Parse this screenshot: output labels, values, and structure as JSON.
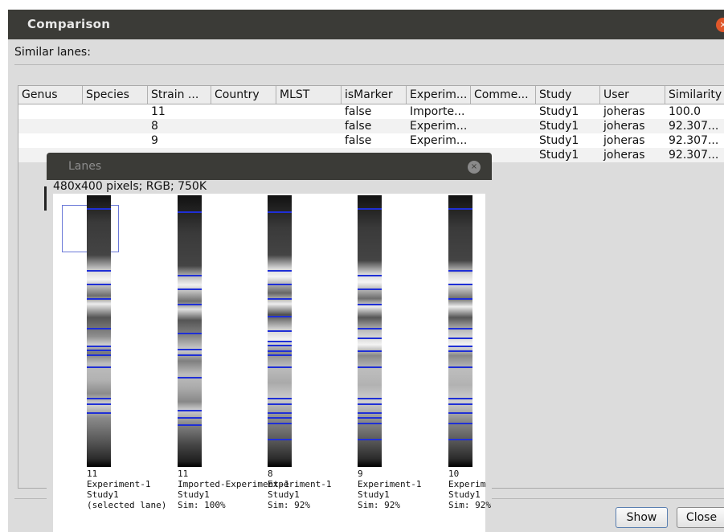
{
  "window": {
    "title": "Comparison",
    "close_icon": "×"
  },
  "similar_label": "Similar lanes:",
  "table": {
    "columns": [
      "Genus",
      "Species",
      "Strain ...",
      "Country",
      "MLST",
      "isMarker",
      "Experim...",
      "Comme...",
      "Study",
      "User",
      "Similarity"
    ],
    "rows": [
      [
        "",
        "",
        "11",
        "",
        "",
        "false",
        "Importe...",
        "",
        "Study1",
        "joheras",
        "100.0"
      ],
      [
        "",
        "",
        "8",
        "",
        "",
        "false",
        "Experim...",
        "",
        "Study1",
        "joheras",
        "92.307..."
      ],
      [
        "",
        "",
        "9",
        "",
        "",
        "false",
        "Experim...",
        "",
        "Study1",
        "joheras",
        "92.307..."
      ],
      [
        "",
        "",
        "",
        "",
        "",
        "",
        "",
        "",
        "Study1",
        "joheras",
        "92.307..."
      ]
    ]
  },
  "buttons": {
    "show": "Show",
    "close": "Close"
  },
  "lanes_window": {
    "title": "Lanes",
    "close_icon": "×",
    "info": "480x400 pixels; RGB; 750K",
    "lanes": [
      {
        "number": "11",
        "experiment": "Experiment-1",
        "study": "Study1",
        "extra": "(selected lane)"
      },
      {
        "number": "11",
        "experiment": "Imported-Experiment-1",
        "study": "Study1",
        "extra": "Sim: 100%"
      },
      {
        "number": "8",
        "experiment": "Experiment-1",
        "study": "Study1",
        "extra": "Sim: 92%"
      },
      {
        "number": "9",
        "experiment": "Experiment-1",
        "study": "Study1",
        "extra": "Sim: 92%"
      },
      {
        "number": "10",
        "experiment": "Experim",
        "study": "Study1",
        "extra": "Sim: 92%"
      }
    ],
    "band_color": "#1f2fd6"
  }
}
